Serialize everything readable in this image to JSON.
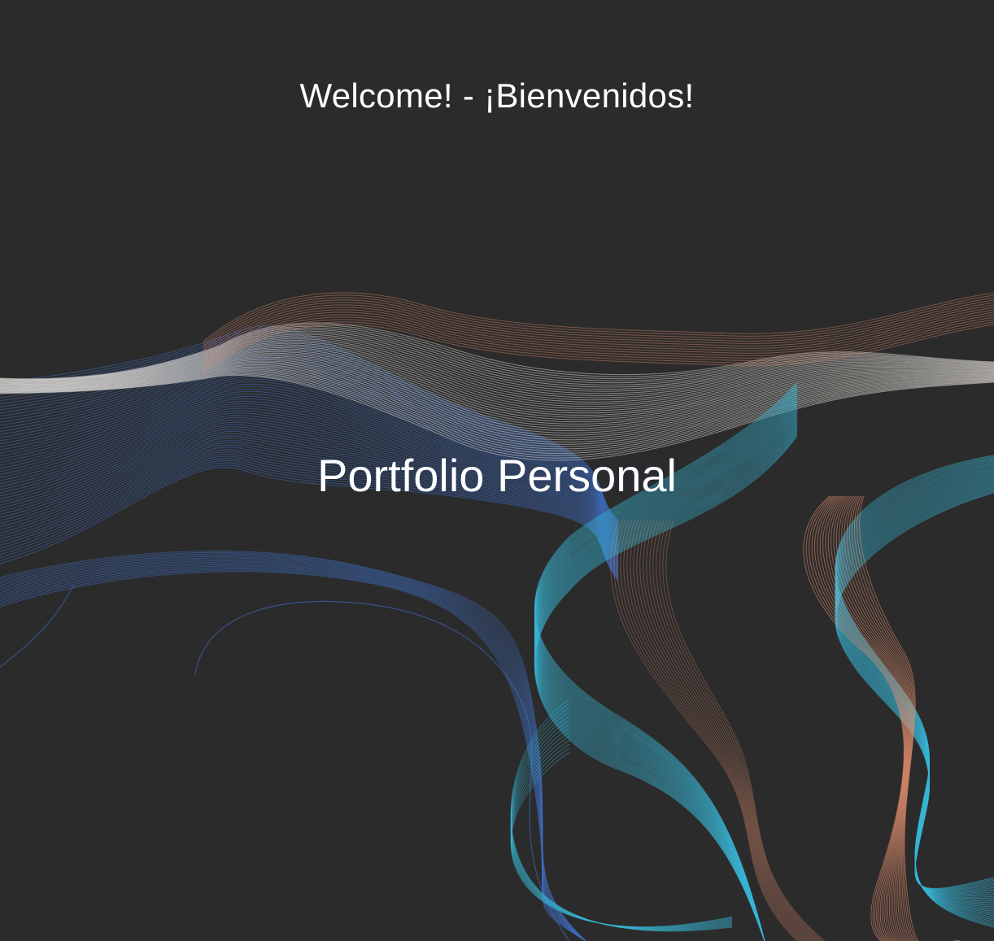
{
  "hero": {
    "welcome_text": "Welcome! - ¡Bienvenidos!",
    "title": "Portfolio Personal"
  },
  "theme": {
    "background": "#2b2b2b",
    "text": "#ffffff",
    "wave_blue": "#3f6fc4",
    "wave_white": "#e9e6df",
    "wave_cyan": "#39b8d8",
    "wave_salmon": "#e58f6f"
  },
  "art": {
    "name": "flowing-line-waves-artwork"
  }
}
